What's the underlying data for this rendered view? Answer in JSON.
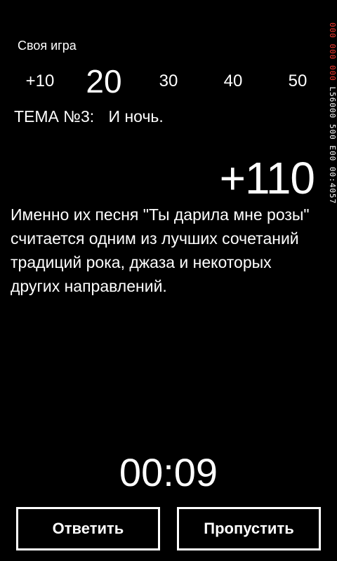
{
  "app": {
    "title": "Своя игра"
  },
  "points": [
    {
      "label": "+10",
      "state": "answered"
    },
    {
      "label": "20",
      "state": "active"
    },
    {
      "label": "30",
      "state": "pending"
    },
    {
      "label": "40",
      "state": "pending"
    },
    {
      "label": "50",
      "state": "pending"
    }
  ],
  "topic": {
    "label": "ТЕМА №3:",
    "name": "И ночь."
  },
  "score": "+110",
  "question": "Именно их песня \"Ты дарила мне розы\" считается одним из лучших сочетаний традиций рока, джаза и некоторых других направлений.",
  "timer": "00:09",
  "buttons": {
    "answer": "Ответить",
    "skip": "Пропустить"
  },
  "debug": {
    "red_text": "000 000 000",
    "white_text": "L56000 500 E00 00:4057"
  },
  "colors": {
    "background": "#000000",
    "foreground": "#ffffff",
    "debug_red": "#ff3b30"
  }
}
